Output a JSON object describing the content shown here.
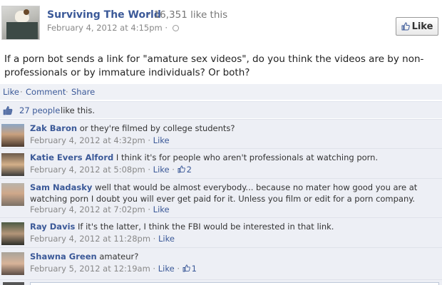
{
  "page": {
    "name": "Surviving The World",
    "like_count": "· 16,351 like this",
    "post_time": "February 4, 2012 at 4:15pm ·",
    "like_button": "Like"
  },
  "post": {
    "text": "If a porn bot sends a link for \"amature sex videos\", do you think the videos are by non-professionals or by immature individuals? Or both?"
  },
  "actions": {
    "like": "Like",
    "comment": "Comment",
    "share": "Share",
    "sep": "·"
  },
  "likes": {
    "people": "27 people",
    "suffix": "like this."
  },
  "comments": [
    {
      "author": "Zak Baron",
      "text": "or they're filmed by college students?",
      "time": "February 4, 2012 at 4:32pm",
      "like": "Like",
      "likes": ""
    },
    {
      "author": "Katie Evers Alford",
      "text": "I think it's for people who aren't professionals at watching porn.",
      "time": "February 4, 2012 at 5:08pm",
      "like": "Like",
      "likes": "2"
    },
    {
      "author": "Sam Nadasky",
      "text": "well that would be almost everybody... because no mater how good you are at watching porn I doubt you will ever get paid for it. Unless you film or edit for a porn company.",
      "time": "February 4, 2012 at 7:02pm",
      "like": "Like",
      "likes": ""
    },
    {
      "author": "Ray Davis",
      "text": "If it's the latter, I think the FBI would be interested in that link.",
      "time": "February 4, 2012 at 11:28pm",
      "like": "Like",
      "likes": ""
    },
    {
      "author": "Shawna Green",
      "text": "amateur?",
      "time": "February 5, 2012 at 12:19am",
      "like": "Like",
      "likes": "1"
    }
  ],
  "colors": {
    "link": "#3b5998",
    "comment_bg": "#edeff5",
    "meta": "#888888"
  },
  "icons": [
    "thumbs-up-icon",
    "globe-icon"
  ]
}
